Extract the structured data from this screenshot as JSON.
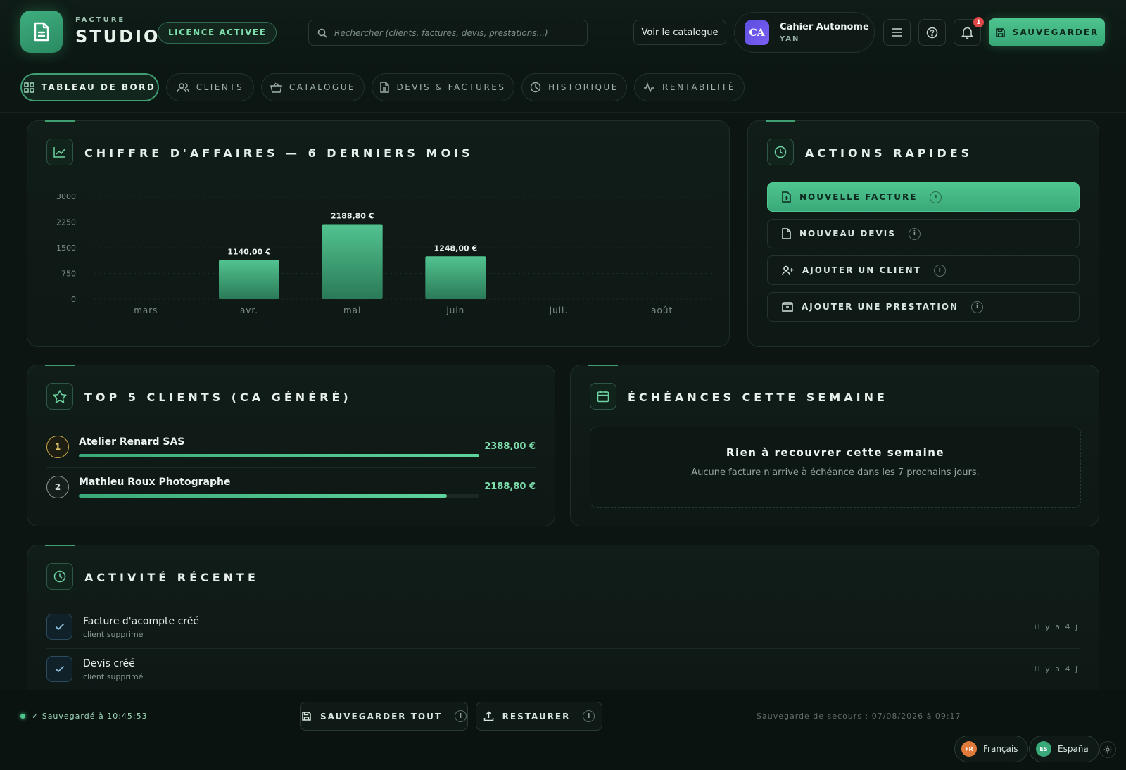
{
  "app": {
    "brand_small": "FACTURE",
    "brand_big": "STUDIO",
    "licence_badge": "LICENCE ACTIVEE"
  },
  "header": {
    "search_placeholder": "Rechercher (clients, factures, devis, prestations...)",
    "catalog_button": "Voir le catalogue",
    "user": {
      "initials": "CA",
      "name": "Cahier Autonome",
      "sub": "YAN"
    },
    "notification_count": "1",
    "save_button": "SAUVEGARDER"
  },
  "nav": {
    "tabs": [
      {
        "label": "TABLEAU DE BORD",
        "icon": "grid-icon",
        "active": true
      },
      {
        "label": "CLIENTS",
        "icon": "users-icon"
      },
      {
        "label": "CATALOGUE",
        "icon": "basket-icon"
      },
      {
        "label": "DEVIS & FACTURES",
        "icon": "document-icon"
      },
      {
        "label": "HISTORIQUE",
        "icon": "clock-icon"
      },
      {
        "label": "RENTABILITÉ",
        "icon": "pulse-icon"
      }
    ]
  },
  "revenue": {
    "title": "CHIFFRE D'AFFAIRES — 6 DERNIERS MOIS"
  },
  "chart_data": {
    "type": "bar",
    "categories": [
      "mars",
      "avr.",
      "mai",
      "juin",
      "juil.",
      "août"
    ],
    "values": [
      0,
      1140.0,
      2188.8,
      1248.0,
      0,
      0
    ],
    "data_labels": [
      "",
      "1140,00 €",
      "2188,80 €",
      "1248,00 €",
      "",
      ""
    ],
    "y_ticks": [
      "0",
      "750",
      "1500",
      "2250",
      "3000"
    ],
    "ylim": [
      0,
      3000
    ],
    "grid": true,
    "xlabel": "",
    "ylabel": ""
  },
  "quick_actions": {
    "title": "ACTIONS RAPIDES",
    "items": [
      {
        "label": "NOUVELLE FACTURE",
        "icon": "file-plus-icon",
        "primary": true
      },
      {
        "label": "NOUVEAU DEVIS",
        "icon": "file-icon"
      },
      {
        "label": "AJOUTER UN CLIENT",
        "icon": "user-plus-icon"
      },
      {
        "label": "AJOUTER UNE PRESTATION",
        "icon": "box-icon"
      }
    ],
    "info_glyph": "i"
  },
  "top_clients": {
    "title": "TOP 5 CLIENTS (CA GÉNÉRÉ)",
    "items": [
      {
        "rank": "1",
        "name": "Atelier Renard SAS",
        "amount": "2388,00 €",
        "share": 1.0
      },
      {
        "rank": "2",
        "name": "Mathieu Roux Photographe",
        "amount": "2188,80 €",
        "share": 0.92
      }
    ]
  },
  "deadlines": {
    "title": "ÉCHÉANCES CETTE SEMAINE",
    "empty_title": "Rien à recouvrer cette semaine",
    "empty_text": "Aucune facture n'arrive à échéance dans les 7 prochains jours."
  },
  "activity": {
    "title": "ACTIVITÉ RÉCENTE",
    "items": [
      {
        "title": "Facture d'acompte créé",
        "sub": "client supprimé",
        "time": "il y a 4 j"
      },
      {
        "title": "Devis créé",
        "sub": "client supprimé",
        "time": "il y a 4 j"
      }
    ]
  },
  "footer": {
    "saved_status": "✓ Sauvegardé à 10:45:53",
    "save_all": "SAUVEGARDER TOUT",
    "restore": "RESTAURER",
    "backup_text": "Sauvegarde de secours : 07/08/2026 à 09:17",
    "languages": [
      {
        "code": "FR",
        "label": "Français",
        "color": "#e07a3a"
      },
      {
        "code": "ES",
        "label": "España",
        "color": "#3aa979"
      }
    ]
  },
  "colors": {
    "accent": "#4ec48f",
    "background": "#0c1512",
    "notification": "#e04848"
  }
}
